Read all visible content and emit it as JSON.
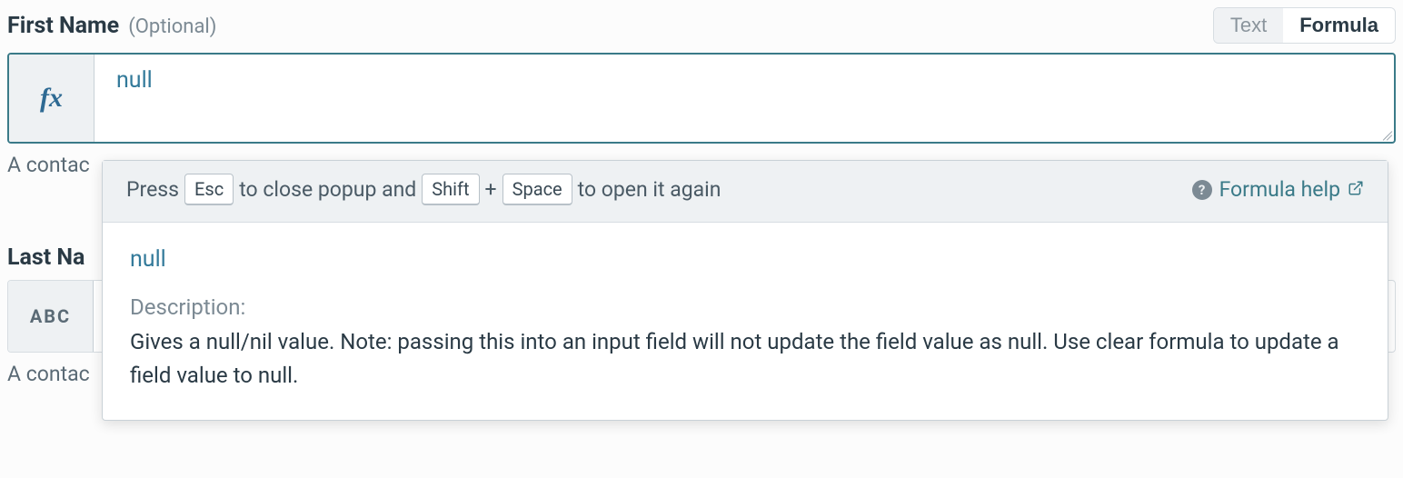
{
  "field1": {
    "label": "First Name",
    "optional": "(Optional)",
    "mode_text": "Text",
    "mode_formula": "Formula",
    "formula_value": "null",
    "hint": "A contac"
  },
  "popup": {
    "hint_press": "Press",
    "key_esc": "Esc",
    "hint_close": "to close popup and",
    "key_shift": "Shift",
    "plus": "+",
    "key_space": "Space",
    "hint_open": "to open it again",
    "help_label": "Formula help",
    "keyword": "null",
    "desc_label": "Description:",
    "desc_text": "Gives a null/nil value. Note: passing this into an input field will not update the field value as null. Use clear formula to update a field value to null."
  },
  "field2": {
    "label": "Last Na",
    "abc": "ABC",
    "hint": "A contac"
  }
}
